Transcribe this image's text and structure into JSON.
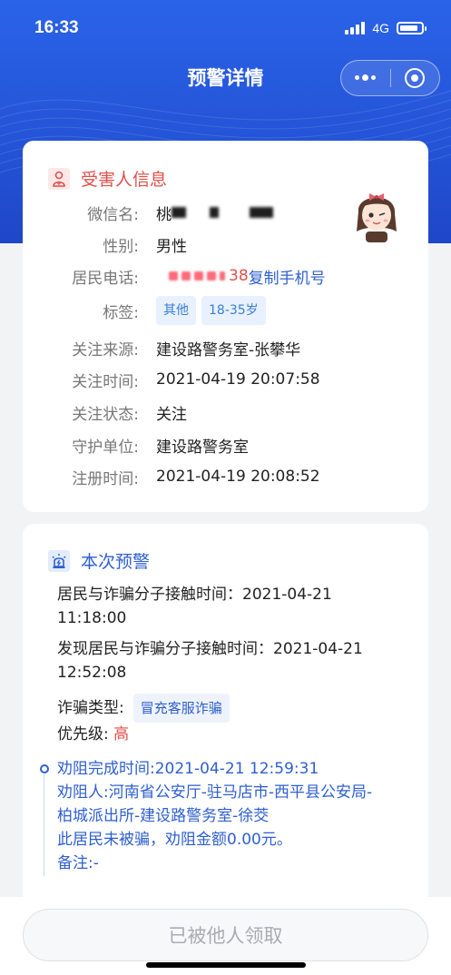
{
  "status_bar": {
    "time": "16:33",
    "network": "4G",
    "signal_icon": "signal-icon",
    "battery_icon": "battery-icon"
  },
  "nav": {
    "title": "预警详情",
    "more_icon": "more-dots-icon",
    "close_icon": "target-circle-icon"
  },
  "victim": {
    "section_title": "受害人信息",
    "section_icon": "person-icon",
    "wechat_label": "微信名:",
    "wechat_value_prefix": "桃",
    "gender_label": "性别:",
    "gender_value": "男性",
    "phone_label": "居民电话:",
    "phone_suffix": "38",
    "copy_phone": "复制手机号",
    "tags_label": "标签:",
    "tags": [
      "其他",
      "18-35岁"
    ],
    "follow_source_label": "关注来源:",
    "follow_source_value": "建设路警务室-张攀华",
    "follow_time_label": "关注时间:",
    "follow_time_value": "2021-04-19 20:07:58",
    "follow_status_label": "关注状态:",
    "follow_status_value": "关注",
    "guard_unit_label": "守护单位:",
    "guard_unit_value": "建设路警务室",
    "register_time_label": "注册时间:",
    "register_time_value": "2021-04-19 20:08:52"
  },
  "warning": {
    "section_title": "本次预警",
    "section_icon": "alarm-icon",
    "contact_time_line1": "居民与诈骗分子接触时间：2021-04-21",
    "contact_time_line2": "11:18:00",
    "found_time_line1": "发现居民与诈骗分子接触时间：2021-04-21",
    "found_time_line2": "12:52:08",
    "fraud_type_label": "诈骗类型:",
    "fraud_type_value": "冒充客服诈骗",
    "priority_label": "优先级:",
    "priority_value": "高",
    "timeline": {
      "done_time": "劝阻完成时间:2021-04-21 12:59:31",
      "persuader_line1": "劝阻人:河南省公安厅-驻马店市-西平县公安局-",
      "persuader_line2": "柏城派出所-建设路警务室-徐茭",
      "result": "此居民未被骗，劝阻金额0.00元。",
      "remark": "备注:-"
    }
  },
  "footer": {
    "claim_button": "已被他人领取"
  },
  "colors": {
    "primary": "#2a63e8",
    "link": "#2e5fcf",
    "danger": "#e0504a",
    "warning": "#e88a2d"
  }
}
